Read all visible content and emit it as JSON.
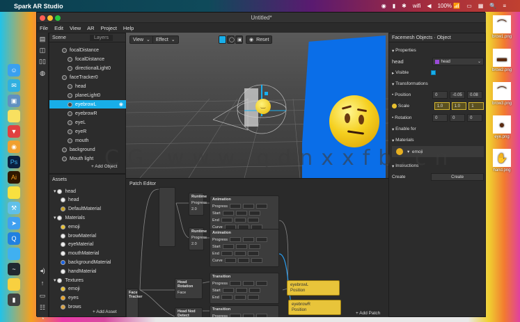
{
  "menubar": {
    "app_name": "Spark AR Studio",
    "status": [
      "◉",
      "▮",
      "✱",
      "wifi",
      "◀",
      "100% 📶",
      "▭",
      "▦",
      "🔍",
      "≡"
    ]
  },
  "window": {
    "title": "Untitled*",
    "menu": [
      "File",
      "Edit",
      "View",
      "AR",
      "Project",
      "Help"
    ]
  },
  "scene": {
    "tabs": [
      "Scene",
      "Layers"
    ],
    "items": [
      {
        "label": "focalDistance",
        "indent": 1,
        "selected": false
      },
      {
        "label": "focalDistance",
        "indent": 2,
        "selected": false
      },
      {
        "label": "directionalLight0",
        "indent": 2,
        "selected": false
      },
      {
        "label": "faceTracker0",
        "indent": 1,
        "selected": false
      },
      {
        "label": "head",
        "indent": 2,
        "selected": false
      },
      {
        "label": "planeLight0",
        "indent": 2,
        "selected": false
      },
      {
        "label": "eyebrowL",
        "indent": 2,
        "selected": true
      },
      {
        "label": "eyebrowR",
        "indent": 2,
        "selected": false
      },
      {
        "label": "eyeL",
        "indent": 2,
        "selected": false
      },
      {
        "label": "eyeR",
        "indent": 2,
        "selected": false
      },
      {
        "label": "mouth",
        "indent": 2,
        "selected": false
      },
      {
        "label": "background",
        "indent": 1,
        "selected": false
      },
      {
        "label": "Mouth light",
        "indent": 1,
        "selected": false
      }
    ],
    "add_label": "+ Add Object"
  },
  "viewport": {
    "view_label": "View",
    "effect_label": "Effect",
    "reset_label": "Reset",
    "material_label": "DefaultMaterial"
  },
  "assets": {
    "title": "Assets",
    "items": [
      {
        "label": "head",
        "group": true,
        "color": "#eeeeee"
      },
      {
        "label": "head",
        "group": false,
        "color": "#eeeeee"
      },
      {
        "label": "DefaultMaterial",
        "group": false,
        "color": "#c8a020"
      },
      {
        "label": "Materials",
        "group": true,
        "color": "#eeeeee"
      },
      {
        "label": "emoji",
        "group": false,
        "color": "#e8c030"
      },
      {
        "label": "browMaterial",
        "group": false,
        "color": "#eeeeee"
      },
      {
        "label": "eyeMaterial",
        "group": false,
        "color": "#eeeeee"
      },
      {
        "label": "mouthMaterial",
        "group": false,
        "color": "#eeeeee"
      },
      {
        "label": "backgroundMaterial",
        "group": false,
        "color": "#1860e0"
      },
      {
        "label": "handMaterial",
        "group": false,
        "color": "#eeeeee"
      },
      {
        "label": "Textures",
        "group": true,
        "color": "#eeeeee"
      },
      {
        "label": "emoji",
        "group": false,
        "color": "#e8c030"
      },
      {
        "label": "eyes",
        "group": false,
        "color": "#e8a020"
      },
      {
        "label": "brows",
        "group": false,
        "color": "#d8a040"
      }
    ],
    "add_label": "+ Add Asset"
  },
  "patch": {
    "title": "Patch Editor",
    "add_label": "+ Add Patch",
    "nodes": [
      {
        "title": "Runtime",
        "fields": [
          "Progress",
          "2.0"
        ]
      },
      {
        "title": "Animation",
        "fields": [
          "Progress",
          "Start",
          "End",
          "Curve"
        ]
      },
      {
        "title": "Runtime",
        "fields": [
          "Progress",
          "2.0"
        ]
      },
      {
        "title": "Animation",
        "fields": [
          "Progress",
          "Start",
          "End",
          "Curve"
        ]
      },
      {
        "title": "Head Rotation",
        "fields": [
          "Face"
        ]
      },
      {
        "title": "Transition",
        "fields": [
          "Progress",
          "Start",
          "End"
        ]
      },
      {
        "title": "Head Nod Detect",
        "fields": [
          "Face"
        ]
      },
      {
        "title": "Transition",
        "fields": [
          "Progress",
          "Start",
          "End"
        ]
      }
    ],
    "outputs": [
      {
        "title": "eyebrowL",
        "field": "Position"
      },
      {
        "title": "eyebrowR",
        "field": "Position"
      }
    ],
    "face_label": "Face Tracker"
  },
  "inspector": {
    "title": "Facemesh Objects · Object",
    "properties_label": "Properties",
    "head_label": "head",
    "head_value": "head",
    "visible_label": "Visible",
    "transform_label": "Transformations",
    "position_label": "Position",
    "position": [
      "0",
      "-0.05",
      "0.08"
    ],
    "scale_label": "Scale",
    "scale": [
      "1.0",
      "1.0",
      "1"
    ],
    "rotation_label": "Rotation",
    "rotation": [
      "0",
      "0",
      "0"
    ],
    "enable_label": "Enable for",
    "materials_label": "Materials",
    "material_value": "emoji",
    "instructions_label": "Instructions",
    "create_label": "Create",
    "create_button": "Create",
    "accent": "#e8c030"
  },
  "desktop": {
    "files": [
      "brow1.png",
      "brow2.png",
      "brow3.png",
      "eye.png",
      "hand.png"
    ]
  },
  "watermark": "CG www.qdnxxfb.cn"
}
